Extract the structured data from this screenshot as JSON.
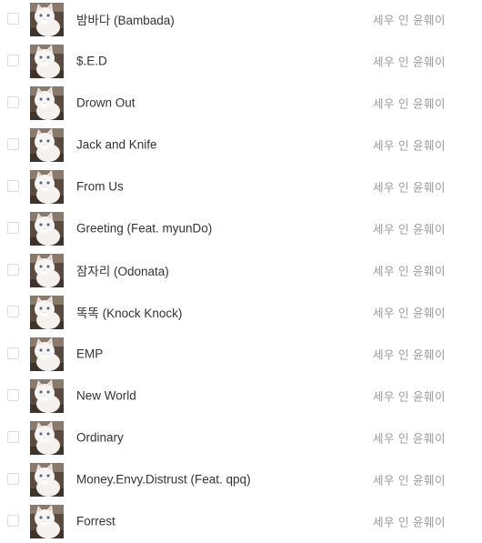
{
  "tracks": [
    {
      "title": "밤바다 (Bambada)",
      "artist": "세우 인 윤훼이",
      "cover": "white-cat-cover"
    },
    {
      "title": "$.E.D",
      "artist": "세우 인 윤훼이",
      "cover": "white-cat-cover"
    },
    {
      "title": "Drown Out",
      "artist": "세우 인 윤훼이",
      "cover": "white-cat-cover"
    },
    {
      "title": "Jack and Knife",
      "artist": "세우 인 윤훼이",
      "cover": "white-cat-cover"
    },
    {
      "title": "From Us",
      "artist": "세우 인 윤훼이",
      "cover": "white-cat-cover"
    },
    {
      "title": "Greeting (Feat. myunDo)",
      "artist": "세우 인 윤훼이",
      "cover": "white-cat-cover"
    },
    {
      "title": "잠자리 (Odonata)",
      "artist": "세우 인 윤훼이",
      "cover": "white-cat-cover"
    },
    {
      "title": "똑똑 (Knock Knock)",
      "artist": "세우 인 윤훼이",
      "cover": "white-cat-cover"
    },
    {
      "title": "EMP",
      "artist": "세우 인 윤훼이",
      "cover": "white-cat-cover"
    },
    {
      "title": "New World",
      "artist": "세우 인 윤훼이",
      "cover": "white-cat-cover"
    },
    {
      "title": "Ordinary",
      "artist": "세우 인 윤훼이",
      "cover": "white-cat-cover"
    },
    {
      "title": "Money.Envy.Distrust (Feat. qpq)",
      "artist": "세우 인 윤훼이",
      "cover": "white-cat-cover"
    },
    {
      "title": "Forrest",
      "artist": "세우 인 윤훼이",
      "cover": "white-cat-cover"
    }
  ],
  "colors": {
    "title_text": "#333333",
    "artist_text": "#9a9a9a",
    "checkbox_border": "#dcdcdc",
    "background": "#ffffff"
  }
}
